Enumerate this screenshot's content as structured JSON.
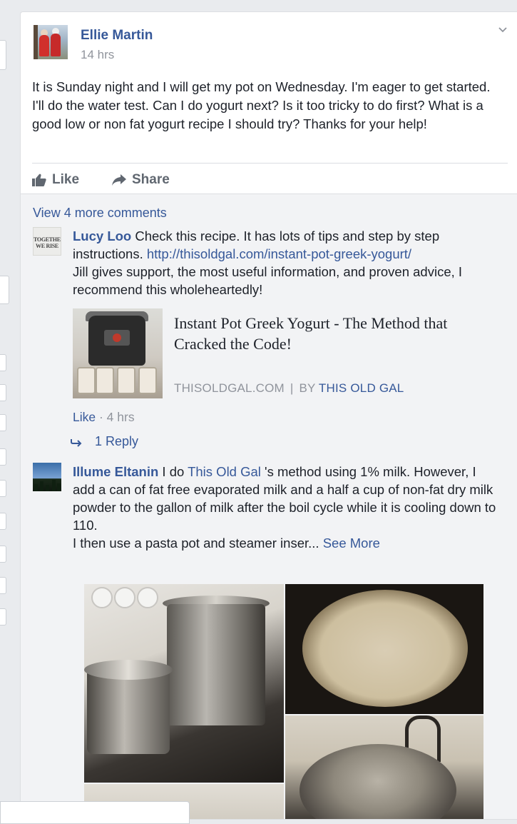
{
  "post": {
    "author": "Ellie Martin",
    "time": "14 hrs",
    "text": "It is Sunday night and I will get my pot on Wednesday. I'm eager to get started. I'll do the water test. Can I do yogurt next? Is it too tricky to do first? What is a good low or non fat yogurt recipe I should try? Thanks for your help!",
    "actions": {
      "like_label": "Like",
      "share_label": "Share"
    }
  },
  "comments_section": {
    "view_more_label": "View 4 more comments",
    "comment1": {
      "author": "Lucy Loo",
      "avatar_text_line1": "TOGETHER,",
      "avatar_text_line2": "WE RISE",
      "text_before_link": " Check this recipe. It has lots of tips and step by step instructions. ",
      "link": "http://thisoldgal.com/instant-pot-greek-yogurt/",
      "text_after_link": "Jill gives support, the most useful information, and proven advice, I recommend this wholeheartedly!",
      "preview": {
        "title": "Instant Pot Greek Yogurt - The Method that Cracked the Code!",
        "domain": "THISOLDGAL.COM",
        "separator": "|",
        "by_label": "BY",
        "by_name": "THIS OLD GAL"
      },
      "like_label": "Like",
      "meta_separator": " · ",
      "time": "4 hrs",
      "reply_label": "1 Reply"
    },
    "comment2": {
      "author": "Illume Eltanin",
      "text_before_mention": " I do ",
      "mention": "This Old Gal",
      "text_after_mention": " 's method using 1% milk. However, I add a can of fat free evaporated milk and a half a cup of non-fat dry milk powder to the gallon of milk after the boil cycle while it is cooling down to 110.",
      "text_line2": "I then use a pasta pot and steamer inser...",
      "see_more_label": "See More"
    }
  },
  "colors": {
    "link_blue": "#365899",
    "meta_gray": "#90949c",
    "action_gray": "#606770",
    "page_bg": "#e9ebee",
    "comments_bg": "#f2f3f5"
  },
  "icons": [
    "chevron-down-icon",
    "thumbs-up-icon",
    "share-arrow-icon",
    "reply-arrow-icon"
  ]
}
